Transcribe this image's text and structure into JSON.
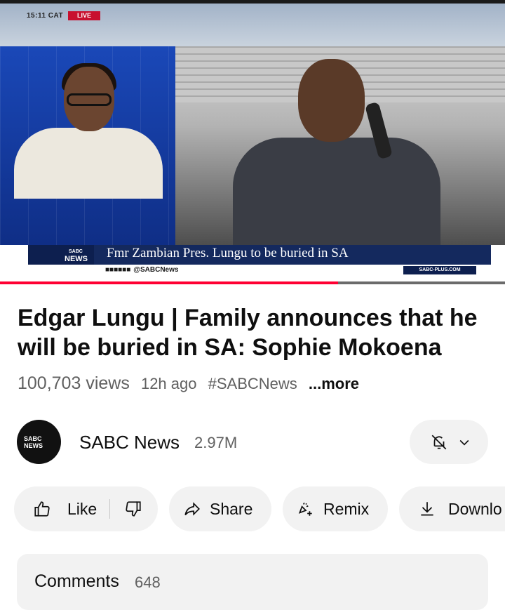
{
  "player": {
    "time_label": "15:11 CAT",
    "live_label": "LIVE",
    "logo_line1": "SABC",
    "logo_line2": "NEWS",
    "headline": "Fmr Zambian Pres. Lungu to be buried in SA",
    "social_handle": "@SABCNews",
    "site_label": "SABC-PLUS.COM",
    "progress_fraction": 0.67
  },
  "video": {
    "title": "Edgar Lungu | Family announces that he will be buried in SA: Sophie Mokoena",
    "views": "100,703 views",
    "age": "12h ago",
    "hashtag": "#SABCNews",
    "more": "...more"
  },
  "channel": {
    "name": "SABC News",
    "subscribers": "2.97M",
    "avatar_text": "SABC NEWS"
  },
  "actions": {
    "like": "Like",
    "share": "Share",
    "remix": "Remix",
    "download": "Downlo"
  },
  "comments": {
    "label": "Comments",
    "count": "648"
  },
  "colors": {
    "accent": "#ff0033",
    "pill_bg": "#f2f2f2",
    "brand_navy": "#14295e"
  }
}
